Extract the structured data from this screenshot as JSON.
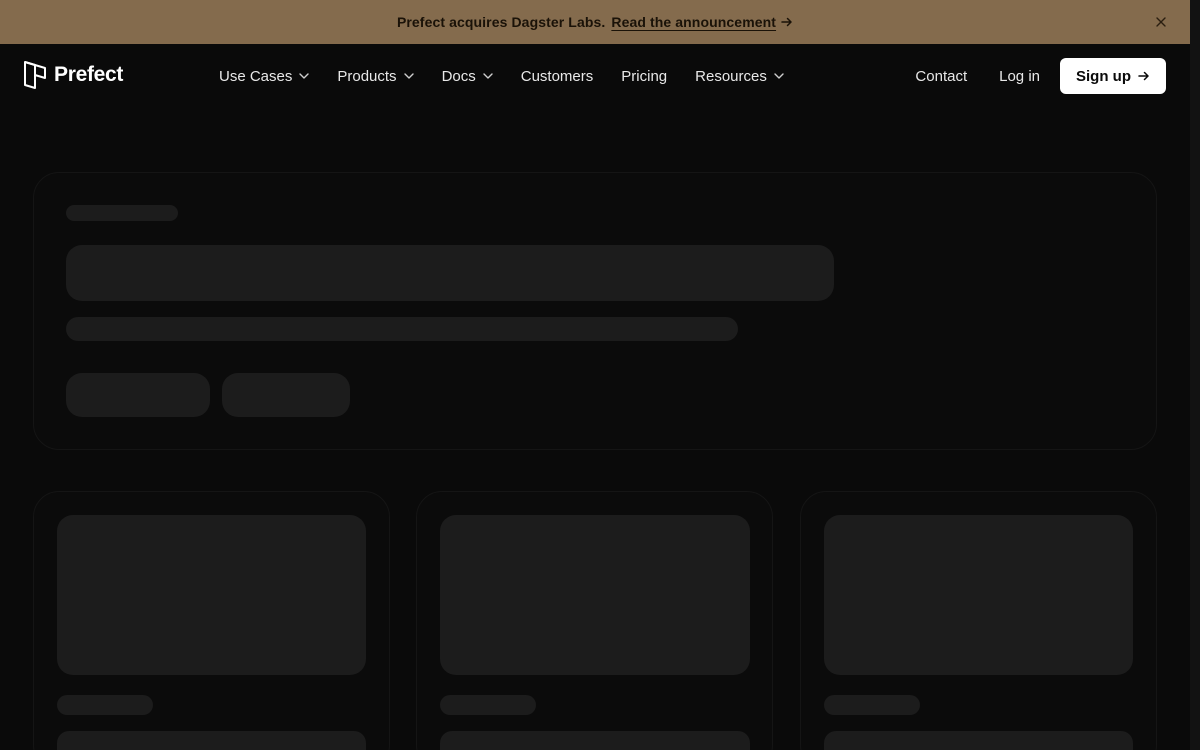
{
  "announcement": {
    "message": "Prefect acquires Dagster Labs.",
    "link_label": "Read the announcement"
  },
  "brand": {
    "name": "Prefect"
  },
  "nav": {
    "items": [
      {
        "label": "Use Cases",
        "has_dropdown": true
      },
      {
        "label": "Products",
        "has_dropdown": true
      },
      {
        "label": "Docs",
        "has_dropdown": true
      },
      {
        "label": "Customers",
        "has_dropdown": false
      },
      {
        "label": "Pricing",
        "has_dropdown": false
      },
      {
        "label": "Resources",
        "has_dropdown": true
      }
    ],
    "contact_label": "Contact",
    "login_label": "Log in",
    "signup_label": "Sign up"
  },
  "colors": {
    "announcement_bg": "#846b4d",
    "page_bg": "#0a0a0a",
    "skeleton": "#1c1c1c",
    "signup_bg": "#ffffff"
  },
  "icons": {
    "logo": "prefect-logo-icon",
    "dropdown": "chevron-down-icon",
    "arrow": "arrow-right-icon",
    "close": "close-icon"
  }
}
